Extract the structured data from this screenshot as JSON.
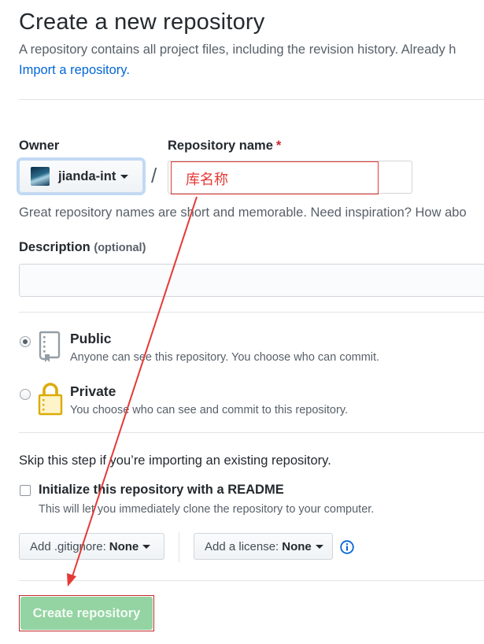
{
  "header": {
    "title": "Create a new repository",
    "subtitle": "A repository contains all project files, including the revision history. Already h",
    "import_link": "Import a repository."
  },
  "owner": {
    "label": "Owner",
    "name": "jianda-int"
  },
  "repo_name": {
    "label": "Repository name",
    "required_mark": "*",
    "separator": "/",
    "value": "库名称",
    "hint": "Great repository names are short and memorable. Need inspiration? How abo"
  },
  "description": {
    "label": "Description",
    "optional": "(optional)",
    "value": ""
  },
  "visibility": {
    "selected": "public",
    "options": [
      {
        "title": "Public",
        "desc": "Anyone can see this repository. You choose who can commit."
      },
      {
        "title": "Private",
        "desc": "You choose who can see and commit to this repository."
      }
    ]
  },
  "init": {
    "skip_note": "Skip this step if you’re importing an existing repository.",
    "readme_label": "Initialize this repository with a README",
    "readme_desc": "This will let you immediately clone the repository to your computer.",
    "readme_checked": false
  },
  "gitignore": {
    "prefix": "Add .gitignore:",
    "value": "None"
  },
  "license": {
    "prefix": "Add a license:",
    "value": "None"
  },
  "submit": {
    "label": "Create repository"
  },
  "colors": {
    "link": "#0366d6",
    "annotation": "#e53935",
    "create_button_disabled": "#94d3a2"
  }
}
